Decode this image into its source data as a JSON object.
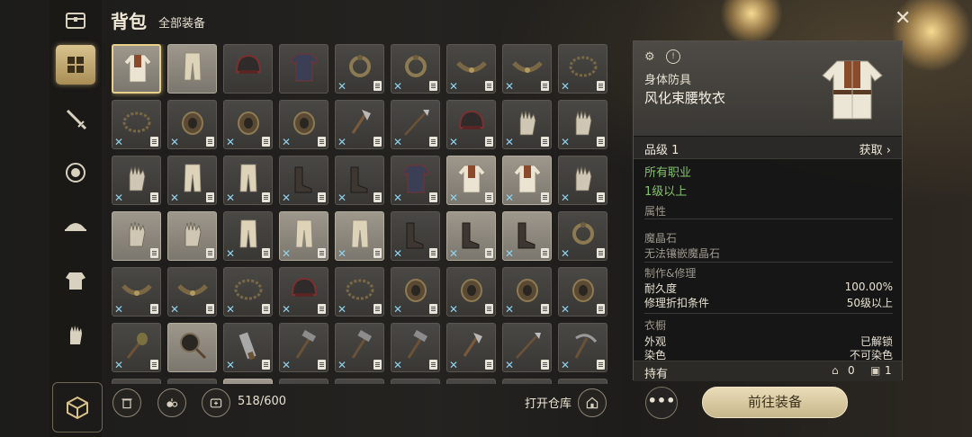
{
  "header": {
    "title": "背包",
    "subtitle": "全部装备"
  },
  "close_icon": "close-icon",
  "sidebar": {
    "items": [
      {
        "name": "chest-icon",
        "active": false
      },
      {
        "name": "grid-icon",
        "active": true
      },
      {
        "name": "sword-icon",
        "active": false
      },
      {
        "name": "shield-icon",
        "active": false
      },
      {
        "name": "hat-icon",
        "active": false
      },
      {
        "name": "armor-icon",
        "active": false
      },
      {
        "name": "gloves-icon",
        "active": false
      }
    ]
  },
  "inventory": {
    "rows": [
      [
        {
          "icon": "robe",
          "bg": "light",
          "x": false,
          "note": false,
          "selected": true
        },
        {
          "icon": "pants",
          "bg": "light",
          "x": false,
          "note": false
        },
        {
          "icon": "helmet",
          "bg": "dark",
          "x": false,
          "note": false
        },
        {
          "icon": "jacket",
          "bg": "dark",
          "x": false,
          "note": false
        },
        {
          "icon": "earring",
          "bg": "dark",
          "x": true,
          "note": true
        },
        {
          "icon": "earring",
          "bg": "dark",
          "x": true,
          "note": true
        },
        {
          "icon": "belt",
          "bg": "dark",
          "x": true,
          "note": true
        },
        {
          "icon": "belt",
          "bg": "dark",
          "x": true,
          "note": true
        },
        {
          "icon": "necklace",
          "bg": "dark",
          "x": true,
          "note": true
        }
      ],
      [
        {
          "icon": "necklace",
          "bg": "dark",
          "x": true,
          "note": true
        },
        {
          "icon": "ring",
          "bg": "dark",
          "x": true,
          "note": true
        },
        {
          "icon": "ring",
          "bg": "dark",
          "x": true,
          "note": true
        },
        {
          "icon": "ring",
          "bg": "dark",
          "x": true,
          "note": true
        },
        {
          "icon": "axe",
          "bg": "dark",
          "x": true,
          "note": true
        },
        {
          "icon": "spear",
          "bg": "dark",
          "x": true,
          "note": true
        },
        {
          "icon": "helmet",
          "bg": "dark",
          "x": true,
          "note": true
        },
        {
          "icon": "glove",
          "bg": "dark",
          "x": true,
          "note": true
        },
        {
          "icon": "glove",
          "bg": "dark",
          "x": true,
          "note": true
        }
      ],
      [
        {
          "icon": "glove",
          "bg": "dark",
          "x": true,
          "note": true
        },
        {
          "icon": "pants",
          "bg": "dark",
          "x": true,
          "note": true
        },
        {
          "icon": "pants",
          "bg": "dark",
          "x": true,
          "note": true
        },
        {
          "icon": "boots",
          "bg": "dark",
          "x": true,
          "note": true
        },
        {
          "icon": "boots",
          "bg": "dark",
          "x": true,
          "note": true
        },
        {
          "icon": "jacket",
          "bg": "dark",
          "x": true,
          "note": true
        },
        {
          "icon": "robe",
          "bg": "light",
          "x": true,
          "note": true
        },
        {
          "icon": "robe",
          "bg": "light",
          "x": true,
          "note": true
        },
        {
          "icon": "glove",
          "bg": "dark",
          "x": true,
          "note": true
        }
      ],
      [
        {
          "icon": "glove",
          "bg": "light",
          "x": false,
          "note": true
        },
        {
          "icon": "glove",
          "bg": "light",
          "x": false,
          "note": true
        },
        {
          "icon": "pants",
          "bg": "dark",
          "x": true,
          "note": true
        },
        {
          "icon": "pants",
          "bg": "light",
          "x": true,
          "note": true
        },
        {
          "icon": "pants",
          "bg": "light",
          "x": true,
          "note": true
        },
        {
          "icon": "boots",
          "bg": "dark",
          "x": true,
          "note": true
        },
        {
          "icon": "boots",
          "bg": "light",
          "x": true,
          "note": true
        },
        {
          "icon": "boots",
          "bg": "light",
          "x": true,
          "note": true
        },
        {
          "icon": "earring",
          "bg": "dark",
          "x": true,
          "note": true
        }
      ],
      [
        {
          "icon": "belt",
          "bg": "dark",
          "x": true,
          "note": true
        },
        {
          "icon": "belt",
          "bg": "dark",
          "x": true,
          "note": true
        },
        {
          "icon": "necklace",
          "bg": "dark",
          "x": true,
          "note": true
        },
        {
          "icon": "helmet",
          "bg": "dark",
          "x": true,
          "note": true
        },
        {
          "icon": "necklace",
          "bg": "dark",
          "x": true,
          "note": true
        },
        {
          "icon": "ring",
          "bg": "dark",
          "x": true,
          "note": true
        },
        {
          "icon": "ring",
          "bg": "dark",
          "x": true,
          "note": true
        },
        {
          "icon": "ring",
          "bg": "dark",
          "x": true,
          "note": true
        },
        {
          "icon": "ring",
          "bg": "dark",
          "x": true,
          "note": true
        }
      ],
      [
        {
          "icon": "mace",
          "bg": "dark",
          "x": true,
          "note": true
        },
        {
          "icon": "pan",
          "bg": "light",
          "x": false,
          "note": false
        },
        {
          "icon": "saw",
          "bg": "dark",
          "x": true,
          "note": true
        },
        {
          "icon": "hammer",
          "bg": "dark",
          "x": true,
          "note": true
        },
        {
          "icon": "hammer",
          "bg": "dark",
          "x": true,
          "note": true
        },
        {
          "icon": "hammer",
          "bg": "dark",
          "x": true,
          "note": true
        },
        {
          "icon": "axe",
          "bg": "dark",
          "x": true,
          "note": true
        },
        {
          "icon": "spear",
          "bg": "dark",
          "x": true,
          "note": true
        },
        {
          "icon": "pick",
          "bg": "dark",
          "x": true,
          "note": true
        }
      ],
      [
        {
          "icon": "none",
          "bg": "dark",
          "x": false,
          "note": false
        },
        {
          "icon": "none",
          "bg": "dark",
          "x": false,
          "note": false
        },
        {
          "icon": "none",
          "bg": "light",
          "x": false,
          "note": false
        },
        {
          "icon": "none",
          "bg": "dark",
          "x": false,
          "note": false
        },
        {
          "icon": "none",
          "bg": "dark",
          "x": false,
          "note": false
        },
        {
          "icon": "none",
          "bg": "dark",
          "x": false,
          "note": false
        },
        {
          "icon": "none",
          "bg": "dark",
          "x": false,
          "note": false
        },
        {
          "icon": "none",
          "bg": "dark",
          "x": false,
          "note": false
        },
        {
          "icon": "none",
          "bg": "dark",
          "x": false,
          "note": false
        }
      ]
    ]
  },
  "bottom": {
    "capacity": "518/600",
    "open_warehouse": "打开仓库",
    "more": "•••"
  },
  "detail": {
    "category": "身体防具",
    "name": "风化束腰牧衣",
    "grade": "品级 1",
    "acquire": "获取",
    "class_req": "所有职业",
    "level_req": "1级以上",
    "attr_title": "属性",
    "crystal_title": "魔晶石",
    "crystal_desc": "无法镶嵌魔晶石",
    "craft_title": "制作&修理",
    "durability_label": "耐久度",
    "durability_value": "100.00%",
    "repair_label": "修理折扣条件",
    "repair_value": "50级以上",
    "wardrobe_title": "衣橱",
    "appearance_label": "外观",
    "appearance_value": "已解锁",
    "dye_label": "染色",
    "dye_value": "不可染色",
    "owned_label": "持有",
    "owned_home": "0",
    "owned_storage": "1"
  },
  "equip_button": "前往装备"
}
